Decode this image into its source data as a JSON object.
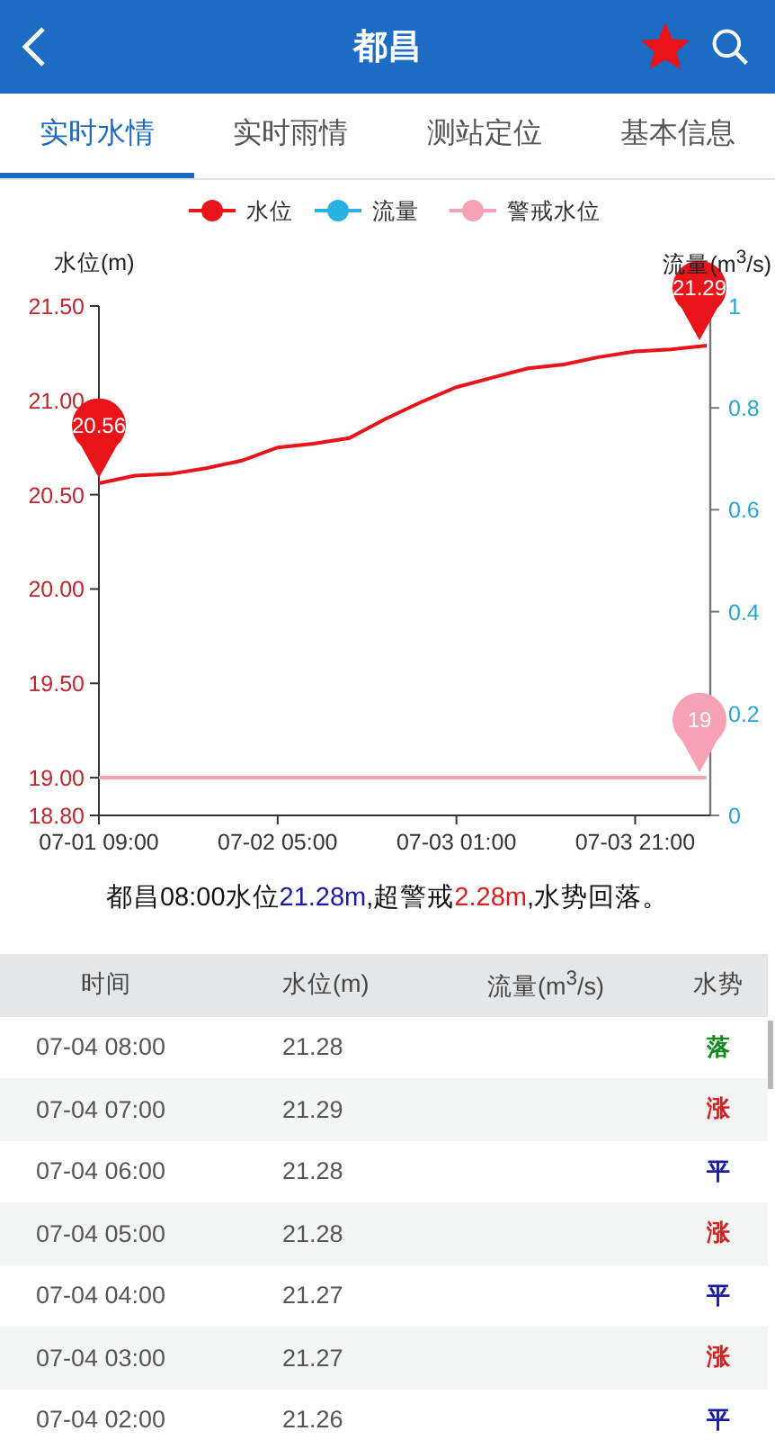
{
  "header": {
    "title": "都昌",
    "favorite": true
  },
  "tabs": [
    {
      "label": "实时水情",
      "selected": true
    },
    {
      "label": "实时雨情",
      "selected": false
    },
    {
      "label": "测站定位",
      "selected": false
    },
    {
      "label": "基本信息",
      "selected": false
    }
  ],
  "chart": {
    "chart_data": {
      "type": "line",
      "ylabel": "水位(m)",
      "y2label": "流量(m$^{3}$/s)",
      "categories": [
        "07-01 09:00",
        null,
        null,
        null,
        null,
        "07-02 05:00",
        null,
        null,
        null,
        null,
        "07-03 01:00",
        null,
        null,
        null,
        null,
        "07-03 21:00",
        null,
        null
      ],
      "ylim": [
        18.8,
        21.5
      ],
      "y2lim": [
        0,
        1
      ],
      "legend": "top",
      "yticks": [
        {
          "value": 18.8,
          "label": "18.80"
        },
        {
          "value": 19,
          "label": "19.00"
        },
        {
          "value": 19.5,
          "label": "19.50"
        },
        {
          "value": 20,
          "label": "20.00"
        },
        {
          "value": 20.5,
          "label": "20.50"
        },
        {
          "value": 21,
          "label": "21.00"
        },
        {
          "value": 21.5,
          "label": "21.50"
        }
      ],
      "y2ticks": [
        {
          "value": 0,
          "label": "0"
        },
        {
          "value": 0.2,
          "label": "0.2"
        },
        {
          "value": 0.4,
          "label": "0.4"
        },
        {
          "value": 0.6,
          "label": "0.6"
        },
        {
          "value": 0.8,
          "label": "0.8"
        },
        {
          "value": 1,
          "label": "1"
        }
      ],
      "series": [
        {
          "name": "水位",
          "color": "#e8141a",
          "values": [
            20.56,
            20.6,
            20.61,
            20.64,
            20.68,
            20.75,
            20.77,
            20.8,
            20.9,
            20.99,
            21.07,
            21.12,
            21.17,
            21.19,
            21.23,
            21.26,
            21.27,
            21.29
          ]
        },
        {
          "name": "流量",
          "color": "#29b1e3",
          "values": [
            null,
            null,
            null,
            null,
            null,
            null,
            null,
            null,
            null,
            null,
            null,
            null,
            null,
            null,
            null,
            null,
            null,
            null
          ]
        },
        {
          "name": "警戒水位",
          "color": "#f7a1b5",
          "values": [
            19,
            19,
            19,
            19,
            19,
            19,
            19,
            19,
            19,
            19,
            19,
            19,
            19,
            19,
            19,
            19,
            19,
            19
          ]
        }
      ],
      "annotations": [
        {
          "y": 20.56,
          "text": "20.56"
        },
        {
          "y": 21.29,
          "text": "21.29"
        },
        {
          "y": 19,
          "text": "19"
        }
      ]
    }
  },
  "summary": [
    {
      "kind": "plain",
      "text": "都昌08:00水位"
    },
    {
      "kind": "level",
      "text": "21.28m"
    },
    {
      "kind": "plain",
      "text": ",超警戒"
    },
    {
      "kind": "over",
      "text": "2.28m"
    },
    {
      "kind": "plain",
      "text": ",水势回落。"
    }
  ],
  "table": {
    "columns": [
      "时间",
      "水位(m)",
      "流量(m$^{3}$/s)",
      "水势"
    ],
    "rows": [
      {
        "time": "07-04 08:00",
        "level": "21.28",
        "trend": "落",
        "color": "#118a1c"
      },
      {
        "time": "07-04 07:00",
        "level": "21.29",
        "trend": "涨",
        "color": "#d61f1f"
      },
      {
        "time": "07-04 06:00",
        "level": "21.28",
        "trend": "平",
        "color": "#1a1aa8"
      },
      {
        "time": "07-04 05:00",
        "level": "21.28",
        "trend": "涨",
        "color": "#d61f1f"
      },
      {
        "time": "07-04 04:00",
        "level": "21.27",
        "trend": "平",
        "color": "#1a1aa8"
      },
      {
        "time": "07-04 03:00",
        "level": "21.27",
        "trend": "涨",
        "color": "#d61f1f"
      },
      {
        "time": "07-04 02:00",
        "level": "21.26",
        "trend": "平",
        "color": "#1a1aa8"
      }
    ]
  }
}
